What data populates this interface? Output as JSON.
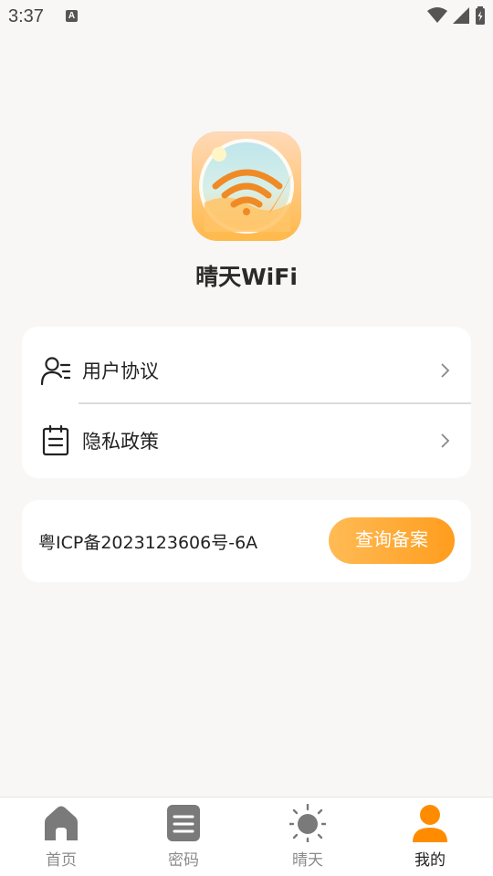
{
  "status_bar": {
    "time": "3:37",
    "icons": [
      "a-notification-icon",
      "wifi-icon",
      "signal-icon",
      "battery-icon"
    ]
  },
  "app": {
    "name": "晴天WiFi",
    "logo_icon": "app-logo-wifi-sun"
  },
  "menu": {
    "items": [
      {
        "label": "用户协议",
        "icon": "user-agreement-icon"
      },
      {
        "label": "隐私政策",
        "icon": "clipboard-icon"
      }
    ]
  },
  "icp": {
    "text": "粤ICP备2023123606号-6A",
    "button_label": "查询备案"
  },
  "bottom_nav": {
    "items": [
      {
        "label": "首页",
        "icon": "home-icon",
        "active": false
      },
      {
        "label": "密码",
        "icon": "document-icon",
        "active": false
      },
      {
        "label": "晴天",
        "icon": "sun-icon",
        "active": false
      },
      {
        "label": "我的",
        "icon": "person-icon",
        "active": true
      }
    ]
  },
  "colors": {
    "accent": "#ff9a1c",
    "background": "#f8f7f5",
    "card": "#ffffff",
    "inactive_nav": "#8a8a8a"
  }
}
